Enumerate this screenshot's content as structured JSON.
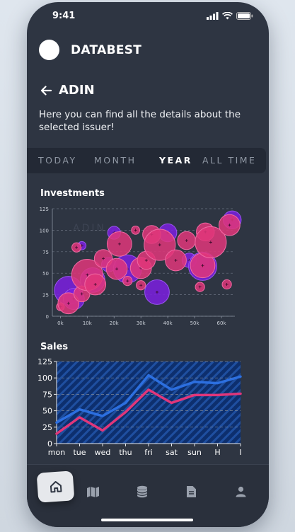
{
  "status": {
    "time": "9:41"
  },
  "brand": {
    "name": "DATABEST"
  },
  "issuer": {
    "name": "ADIN",
    "description": "Here you can find all the details about the selected issuer!"
  },
  "tabs": [
    {
      "label": "TODAY",
      "active": false
    },
    {
      "label": "MONTH",
      "active": false
    },
    {
      "label": "YEAR",
      "active": true
    },
    {
      "label": "ALL TIME",
      "active": false
    }
  ],
  "nav": [
    "home-icon",
    "map-icon",
    "database-icon",
    "document-icon",
    "user-icon"
  ],
  "chart_data": [
    {
      "type": "scatter",
      "title": "Investments",
      "watermark": "ADIN",
      "xticks": [
        "0k",
        "10k",
        "20k",
        "30k",
        "40k",
        "50k",
        "60k"
      ],
      "yticks": [
        0,
        25,
        50,
        75,
        100,
        125
      ],
      "xlim": [
        -3,
        65
      ],
      "ylim": [
        0,
        125
      ],
      "grid": true,
      "colors": {
        "purple": "#7b1fe0",
        "pink": "#e0367a"
      },
      "series": [
        {
          "color": "purple",
          "points": [
            {
              "x": 3,
              "y": 30,
              "r": 4.7
            },
            {
              "x": 5,
              "y": 20,
              "r": 3.3
            },
            {
              "x": 8,
              "y": 82,
              "r": 0.8
            },
            {
              "x": 12,
              "y": 42,
              "r": 4
            },
            {
              "x": 18,
              "y": 60,
              "r": 2
            },
            {
              "x": 20,
              "y": 97,
              "r": 1.7
            },
            {
              "x": 25,
              "y": 55,
              "r": 4.7
            },
            {
              "x": 36,
              "y": 28,
              "r": 4
            },
            {
              "x": 40,
              "y": 97,
              "r": 2.7
            },
            {
              "x": 48,
              "y": 65,
              "r": 2
            },
            {
              "x": 53,
              "y": 58,
              "r": 4.7
            },
            {
              "x": 64,
              "y": 112,
              "r": 2.7
            }
          ]
        },
        {
          "color": "pink",
          "points": [
            {
              "x": 0,
              "y": 11,
              "r": 0.7
            },
            {
              "x": 3,
              "y": 15,
              "r": 3.3
            },
            {
              "x": 6,
              "y": 80,
              "r": 1
            },
            {
              "x": 8,
              "y": 26,
              "r": 2.3
            },
            {
              "x": 10,
              "y": 48,
              "r": 5.3
            },
            {
              "x": 13,
              "y": 37,
              "r": 3.3
            },
            {
              "x": 16,
              "y": 67,
              "r": 2.7
            },
            {
              "x": 21,
              "y": 55,
              "r": 3.3
            },
            {
              "x": 22,
              "y": 84,
              "r": 4
            },
            {
              "x": 25,
              "y": 41,
              "r": 1
            },
            {
              "x": 28,
              "y": 100,
              "r": 0.8
            },
            {
              "x": 30,
              "y": 56,
              "r": 3.3
            },
            {
              "x": 30,
              "y": 36,
              "r": 1
            },
            {
              "x": 32,
              "y": 65,
              "r": 2.7
            },
            {
              "x": 34,
              "y": 95,
              "r": 2.7
            },
            {
              "x": 37,
              "y": 83,
              "r": 5.3
            },
            {
              "x": 43,
              "y": 65,
              "r": 3.3
            },
            {
              "x": 47,
              "y": 88,
              "r": 2.7
            },
            {
              "x": 52,
              "y": 34,
              "r": 1
            },
            {
              "x": 53,
              "y": 59,
              "r": 4
            },
            {
              "x": 54,
              "y": 98,
              "r": 2.7
            },
            {
              "x": 56,
              "y": 86,
              "r": 5.3
            },
            {
              "x": 62,
              "y": 37,
              "r": 1
            },
            {
              "x": 63,
              "y": 106,
              "r": 3.3
            }
          ]
        }
      ]
    },
    {
      "type": "line",
      "title": "Sales",
      "categories": [
        "mon",
        "tue",
        "wed",
        "thu",
        "fri",
        "sat",
        "sun",
        "H",
        "I"
      ],
      "yticks": [
        0,
        25,
        50,
        75,
        100,
        125
      ],
      "ylim": [
        0,
        125
      ],
      "grid": true,
      "colors": {
        "area": "#0d2f6e",
        "hatch": "#1f4fa0",
        "series1": "#2c6fe0",
        "series2": "#e0367a"
      },
      "series": [
        {
          "color": "series1",
          "values": [
            32,
            52,
            42,
            62,
            104,
            82,
            94,
            92,
            102
          ]
        },
        {
          "color": "series2",
          "values": [
            15,
            40,
            20,
            48,
            82,
            62,
            74,
            74,
            76
          ]
        }
      ]
    }
  ]
}
